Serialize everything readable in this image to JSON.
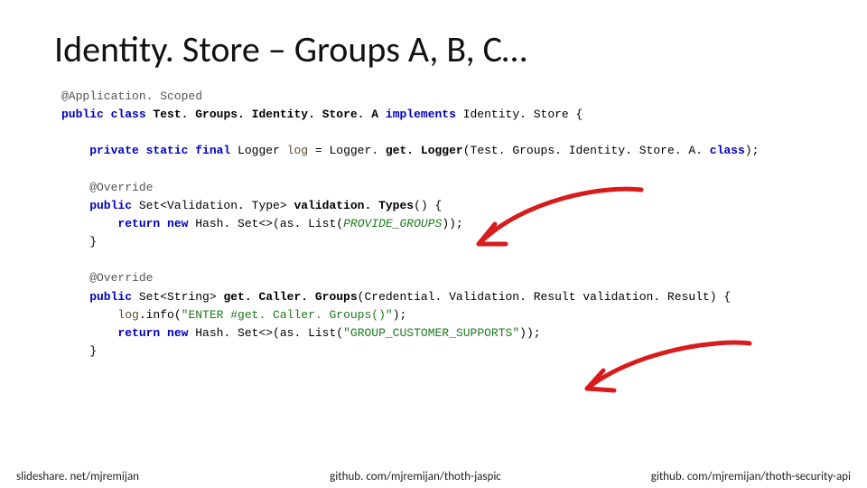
{
  "title": "Identity. Store – Groups A, B, C…",
  "code": {
    "l1a": "@Application. Scoped",
    "l2_pub": "public",
    "l2_cls": "class",
    "l2_name": " Test. Groups. Identity. Store. A ",
    "l2_impl": "implements",
    "l2_is": " Identity. Store {",
    "l3_psf": "    private static final",
    "l3_type": " Logger ",
    "l3_var": "log",
    "l3_eq": " = Logger. ",
    "l3_call": "get. Logger",
    "l3_arg": "(Test. Groups. Identity. Store. A. ",
    "l3_cls": "class",
    "l3_end": ");",
    "l4_ov": "    @Override",
    "l5_pub": "    public",
    "l5_ret": " Set<Validation. Type> ",
    "l5_name": "validation. Types",
    "l5_par": "() {",
    "l6_ret": "        return",
    "l6_new": " new",
    "l6_hs": " Hash. Set<>(",
    "l6_as": "as. List",
    "l6_open": "(",
    "l6_const": "PROVIDE_GROUPS",
    "l6_close": "));",
    "l7": "    }",
    "l8_ov": "    @Override",
    "l9_pub": "    public",
    "l9_ret": " Set<String> ",
    "l9_name": "get. Caller. Groups",
    "l9_par": "(Credential. Validation. Result validation. Result) {",
    "l10_log": "        log",
    "l10_info": ".info(",
    "l10_str": "\"ENTER #get. Caller. Groups()\"",
    "l10_end": ");",
    "l11_ret": "        return",
    "l11_new": " new",
    "l11_hs": " Hash. Set<>(",
    "l11_as": "as. List",
    "l11_open": "(",
    "l11_str": "\"GROUP_CUSTOMER_SUPPORTS\"",
    "l11_close": "));",
    "l12": "    }"
  },
  "footer": {
    "left": "slideshare. net/mjremijan",
    "mid": "github. com/mjremijan/thoth-jaspic",
    "right": "github. com/mjremijan/thoth-security-api"
  },
  "colors": {
    "arrow": "#d81b1b"
  }
}
